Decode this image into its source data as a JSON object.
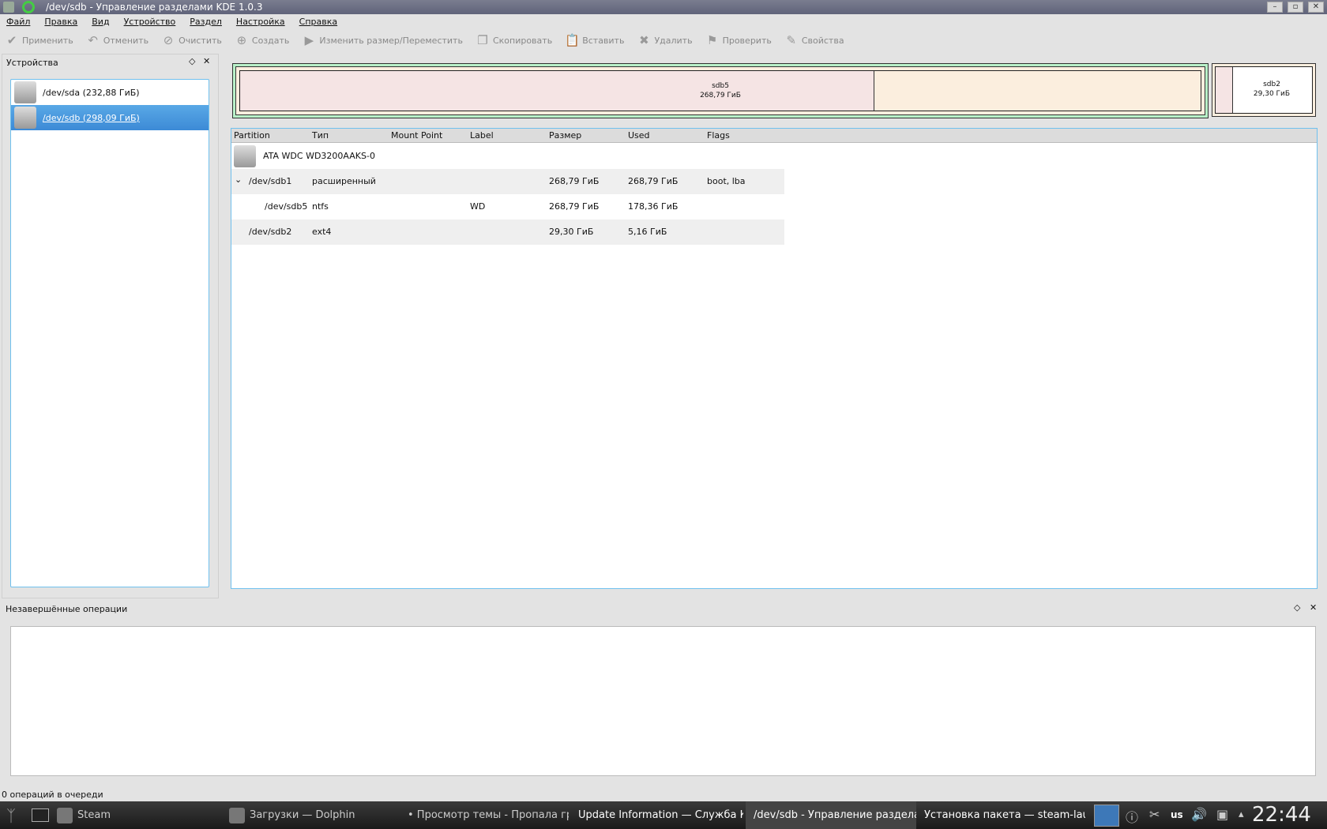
{
  "window": {
    "title": "/dev/sdb - Управление разделами KDE 1.0.3",
    "minimize": "–",
    "maximize": "▫",
    "close": "✕"
  },
  "menu": [
    "Файл",
    "Правка",
    "Вид",
    "Устройство",
    "Раздел",
    "Настройка",
    "Справка"
  ],
  "toolbar": [
    {
      "label": "Применить",
      "icon": "check-icon",
      "glyph": "✔"
    },
    {
      "label": "Отменить",
      "icon": "undo-icon",
      "glyph": "↶"
    },
    {
      "label": "Очистить",
      "icon": "clear-icon",
      "glyph": "⊘"
    },
    {
      "label": "Создать",
      "icon": "new-icon",
      "glyph": "⊕"
    },
    {
      "label": "Изменить размер/Переместить",
      "icon": "resize-icon",
      "glyph": "▶"
    },
    {
      "label": "Скопировать",
      "icon": "copy-icon",
      "glyph": "❐"
    },
    {
      "label": "Вставить",
      "icon": "paste-icon",
      "glyph": "📋"
    },
    {
      "label": "Удалить",
      "icon": "delete-icon",
      "glyph": "✖"
    },
    {
      "label": "Проверить",
      "icon": "flag-icon",
      "glyph": "⚑"
    },
    {
      "label": "Свойства",
      "icon": "properties-icon",
      "glyph": "✎"
    }
  ],
  "devices": {
    "title": "Устройства",
    "items": [
      {
        "label": "/dev/sda (232,88 ГиБ)",
        "selected": false
      },
      {
        "label": "/dev/sdb (298,09 ГиБ)",
        "selected": true
      }
    ]
  },
  "map": {
    "sdb5": {
      "name": "sdb5",
      "size": "268,79 ГиБ",
      "used_fraction": 0.66
    },
    "sdb2": {
      "name": "sdb2",
      "size": "29,30 ГиБ",
      "used_fraction": 0.18
    }
  },
  "table": {
    "columns": [
      "Partition",
      "Тип",
      "Mount Point",
      "Label",
      "Размер",
      "Used",
      "Flags"
    ],
    "disk": "ATA WDC WD3200AAKS-0",
    "rows": [
      {
        "partition": "/dev/sdb1",
        "type": "расширенный",
        "mount": "",
        "label": "",
        "size": "268,79 ГиБ",
        "used": "268,79 ГиБ",
        "flags": "boot, lba"
      },
      {
        "partition": "/dev/sdb5",
        "type": "ntfs",
        "mount": "",
        "label": "WD",
        "size": "268,79 ГиБ",
        "used": "178,36 ГиБ",
        "flags": ""
      },
      {
        "partition": "/dev/sdb2",
        "type": "ext4",
        "mount": "",
        "label": "",
        "size": "29,30 ГиБ",
        "used": "5,16 ГиБ",
        "flags": ""
      }
    ]
  },
  "pending": {
    "title": "Незавершённые операции"
  },
  "status": "0 операций в очереди",
  "taskbar": {
    "tasks": [
      "Steam",
      "Загрузки — Dolphin",
      "• Просмотр темы - Пропала гр",
      "Update Information — Служба К",
      "/dev/sdb - Управление раздела",
      "Установка пакета — steam-laun"
    ],
    "layout": "us",
    "clock": "22:44"
  }
}
